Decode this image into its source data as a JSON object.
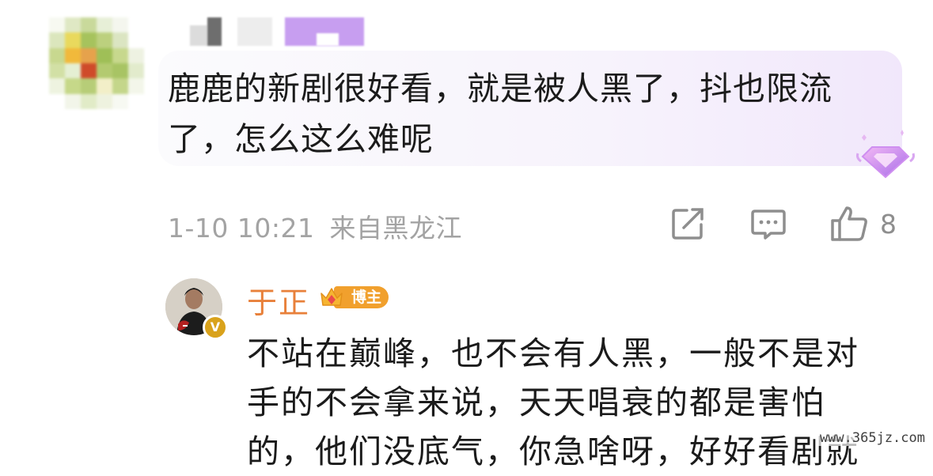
{
  "comment": {
    "text_line1": "鹿鹿的新剧很好看，就是被人黑了，抖也限流",
    "text_line2": "了，怎么这么难呢",
    "time": "1-10 10:21",
    "location": "来自黑龙江",
    "like_count": "8",
    "icons": [
      "share-icon",
      "comment-icon",
      "like-icon",
      "diamond-badge-icon"
    ]
  },
  "reply": {
    "author": "于正",
    "badge_label": "博主",
    "text_line1": "不站在巅峰，也不会有人黑，一般不是对",
    "text_line2": "手的不会拿来说，天天唱衰的都是害怕",
    "text_line3": "的，他们没底气，你急啥呀，好好看剧就"
  },
  "watermark": "www.365jz.com",
  "colors": {
    "author_name": "#e8803a",
    "badge": "#f1a02d",
    "meta_text": "#a3a3a3",
    "bubble_tint": "#f1e7fb"
  }
}
